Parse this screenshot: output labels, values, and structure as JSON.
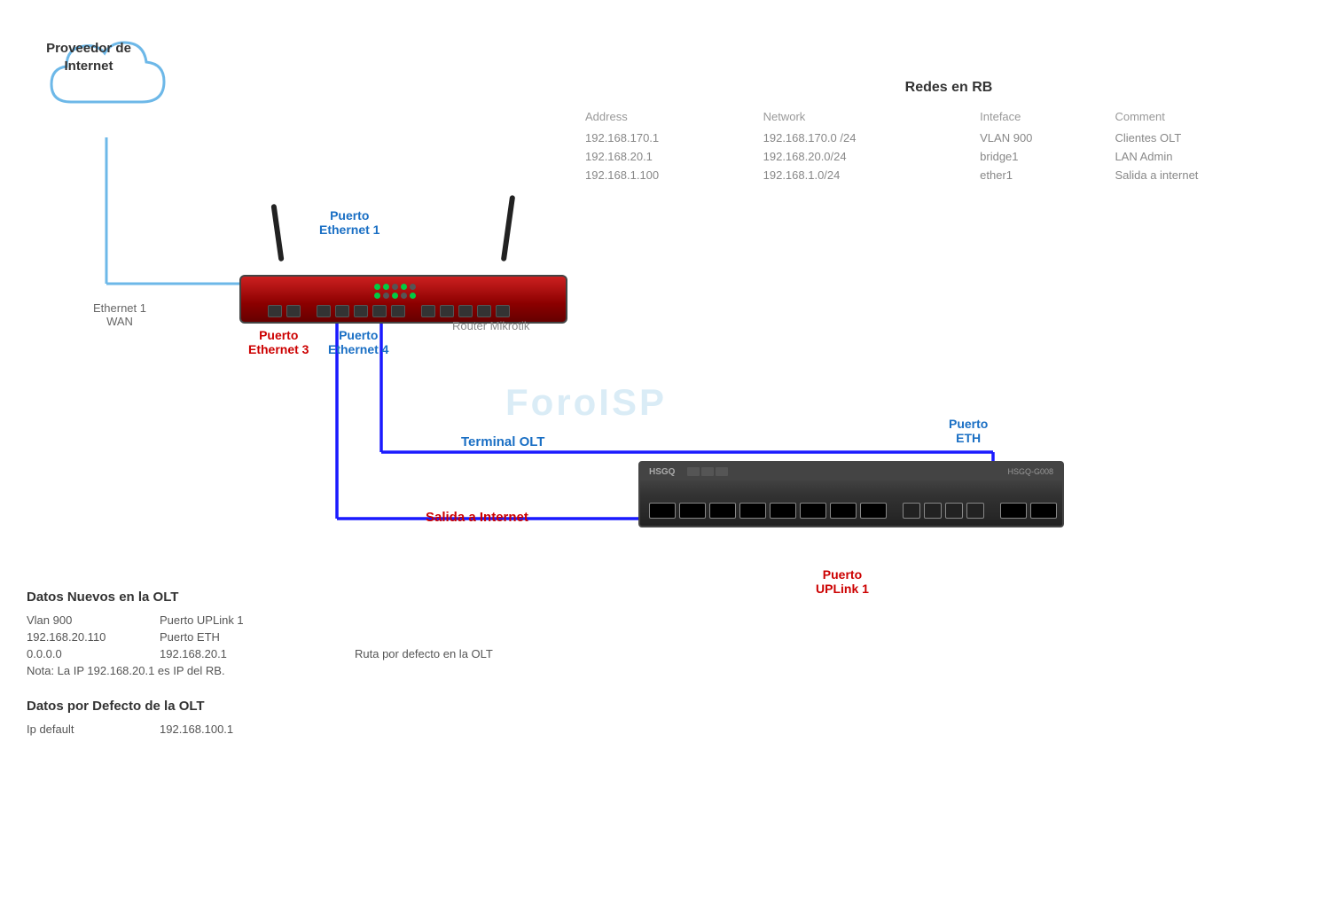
{
  "cloud": {
    "label_line1": "Proveedor de",
    "label_line2": "Internet"
  },
  "wan_label": {
    "line1": "Ethernet 1",
    "line2": "WAN"
  },
  "router": {
    "label": "Router Mikrotik",
    "eth1_label_line1": "Puerto",
    "eth1_label_line2": "Ethernet 1",
    "eth3_label_line1": "Puerto",
    "eth3_label_line2": "Ethernet 3",
    "eth4_label_line1": "Puerto",
    "eth4_label_line2": "Ethernet 4"
  },
  "olt": {
    "terminal_label_line1": "Terminal OLT",
    "salida_label_line1": "Salida a Internet",
    "eth_label_line1": "Puerto",
    "eth_label_line2": "ETH",
    "uplink_label_line1": "Puerto",
    "uplink_label_line2": "UPLink 1"
  },
  "watermark": "ForoISP",
  "table": {
    "title": "Redes en RB",
    "headers": [
      "Address",
      "Network",
      "Inteface",
      "Comment"
    ],
    "rows": [
      [
        "192.168.170.1",
        "192.168.170.0 /24",
        "VLAN 900",
        "Clientes OLT"
      ],
      [
        "192.168.20.1",
        "192.168.20.0/24",
        "bridge1",
        "LAN Admin"
      ],
      [
        "192.168.1.100",
        "192.168.1.0/24",
        "ether1",
        "Salida a internet"
      ]
    ]
  },
  "bottom": {
    "section1_title": "Datos Nuevos en  la OLT",
    "rows": [
      {
        "col1": "Vlan 900",
        "col2": "Puerto UPLink 1",
        "col3": ""
      },
      {
        "col1": "192.168.20.110",
        "col2": "Puerto ETH",
        "col3": ""
      },
      {
        "col1": "0.0.0.0",
        "col2": "192.168.20.1",
        "col3": "Ruta  por defecto en la OLT"
      }
    ],
    "note": "Nota: La IP 192.168.20.1 es IP del RB.",
    "section2_title": "Datos por Defecto de la OLT",
    "default_rows": [
      {
        "col1": "Ip default",
        "col2": "192.168.100.1",
        "col3": ""
      }
    ]
  }
}
